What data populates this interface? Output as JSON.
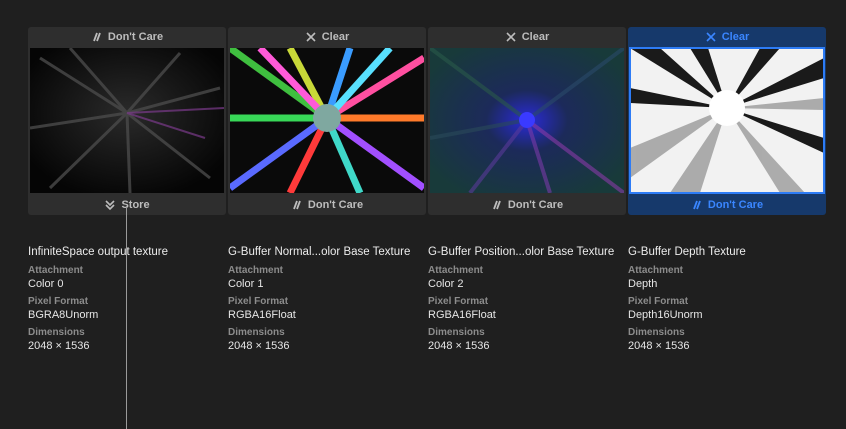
{
  "attachments": [
    {
      "load_action": "Don't Care",
      "load_icon": "dont-care-icon",
      "store_action": "Store",
      "store_icon": "store-icon",
      "name": "InfiniteSpace output texture",
      "attachment_label": "Attachment",
      "attachment": "Color 0",
      "pixel_format_label": "Pixel Format",
      "pixel_format": "BGRA8Unorm",
      "dimensions_label": "Dimensions",
      "dimensions": "2048 × 1536",
      "selected": false
    },
    {
      "load_action": "Clear",
      "load_icon": "clear-icon",
      "store_action": "Don't Care",
      "store_icon": "dont-care-icon",
      "name": "G-Buffer Normal...olor Base Texture",
      "attachment_label": "Attachment",
      "attachment": "Color 1",
      "pixel_format_label": "Pixel Format",
      "pixel_format": "RGBA16Float",
      "dimensions_label": "Dimensions",
      "dimensions": "2048 × 1536",
      "selected": false
    },
    {
      "load_action": "Clear",
      "load_icon": "clear-icon",
      "store_action": "Don't Care",
      "store_icon": "dont-care-icon",
      "name": "G-Buffer Position...olor Base Texture",
      "attachment_label": "Attachment",
      "attachment": "Color 2",
      "pixel_format_label": "Pixel Format",
      "pixel_format": "RGBA16Float",
      "dimensions_label": "Dimensions",
      "dimensions": "2048 × 1536",
      "selected": false
    },
    {
      "load_action": "Clear",
      "load_icon": "clear-icon",
      "store_action": "Don't Care",
      "store_icon": "dont-care-icon",
      "name": "G-Buffer Depth Texture",
      "attachment_label": "Attachment",
      "attachment": "Depth",
      "pixel_format_label": "Pixel Format",
      "pixel_format": "Depth16Unorm",
      "dimensions_label": "Dimensions",
      "dimensions": "2048 × 1536",
      "selected": true
    }
  ],
  "colors": {
    "selected_accent": "#2d7cf6",
    "selected_bg": "#16396b",
    "card_bg": "#2e2e2e",
    "page_bg": "#1f1f1f"
  }
}
